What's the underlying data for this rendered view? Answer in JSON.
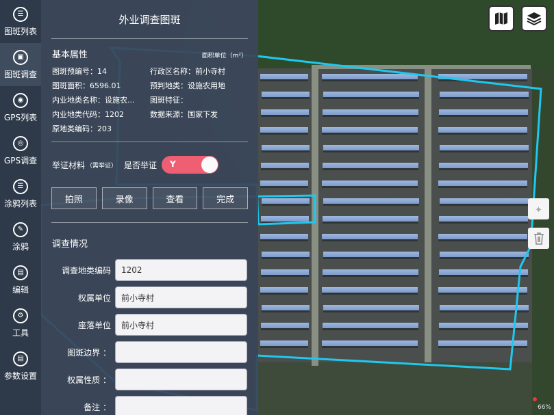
{
  "panel": {
    "title": "外业调查图斑",
    "basic": {
      "title": "基本属性",
      "area_unit": "面积单位（m²）",
      "attrs": [
        "图斑预编号：14",
        "行政区名称：前小寺村",
        "图斑面积：6596.01",
        "预判地类：设施农用地",
        "内业地类名称：设施农...",
        "图斑特征：",
        "内业地类代码：1202",
        "数据来源：国家下发",
        "原地类编码：203",
        ""
      ]
    },
    "evidence": {
      "label": "举证材料",
      "note": "（需举证）",
      "question": "是否举证",
      "toggle_value": "Y"
    },
    "buttons": [
      "拍照",
      "录像",
      "查看",
      "完成"
    ],
    "survey": {
      "title": "调查情况",
      "fields": [
        {
          "label": "调查地类编码",
          "value": "1202"
        },
        {
          "label": "权属单位",
          "value": "前小寺村"
        },
        {
          "label": "座落单位",
          "value": "前小寺村"
        },
        {
          "label": "图斑边界 ：",
          "value": ""
        },
        {
          "label": "权属性质 ：",
          "value": ""
        },
        {
          "label": "备注 ：",
          "value": ""
        }
      ]
    }
  },
  "nav": [
    {
      "label": "图斑列表",
      "icon": "list-icon"
    },
    {
      "label": "图斑调查",
      "icon": "survey-icon",
      "active": true
    },
    {
      "label": "GPS列表",
      "icon": "gps-list-icon"
    },
    {
      "label": "GPS调查",
      "icon": "gps-survey-icon"
    },
    {
      "label": "涂鸦列表",
      "icon": "doodle-list-icon"
    },
    {
      "label": "涂鸦",
      "icon": "doodle-icon"
    },
    {
      "label": "编辑",
      "icon": "edit-icon"
    },
    {
      "label": "工具",
      "icon": "tools-icon"
    },
    {
      "label": "参数设置",
      "icon": "settings-icon"
    }
  ],
  "map": {
    "zoom": "66%",
    "parcel_color": "#1fc8ee",
    "toggle_color": "#ee5f73"
  }
}
